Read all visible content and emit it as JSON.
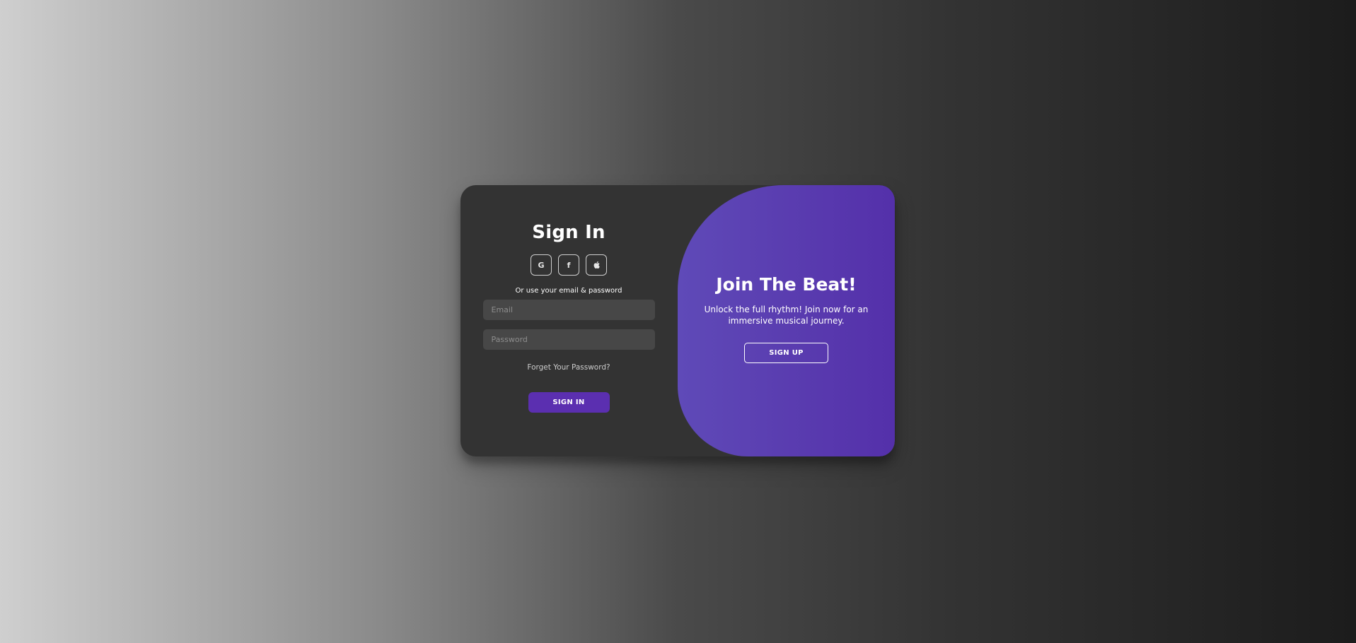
{
  "sign_in": {
    "title": "Sign In",
    "social": [
      {
        "icon": "google-icon",
        "glyph": "G"
      },
      {
        "icon": "facebook-icon",
        "glyph": "f"
      },
      {
        "icon": "apple-icon",
        "glyph": ""
      }
    ],
    "divider_text": "Or use your email & password",
    "email_placeholder": "Email",
    "password_placeholder": "Password",
    "forgot_label": "Forget Your Password?",
    "submit_label": "SIGN IN"
  },
  "promo": {
    "title": "Join The Beat!",
    "text": "Unlock the full rhythm! Join now for an immersive musical journey.",
    "signup_label": "SIGN UP"
  },
  "colors": {
    "card": "#333333",
    "accent": "#5b2fb0",
    "promo_gradient_start": "#5f4ab8",
    "promo_gradient_end": "#5430aa",
    "input_bg": "#474747"
  }
}
